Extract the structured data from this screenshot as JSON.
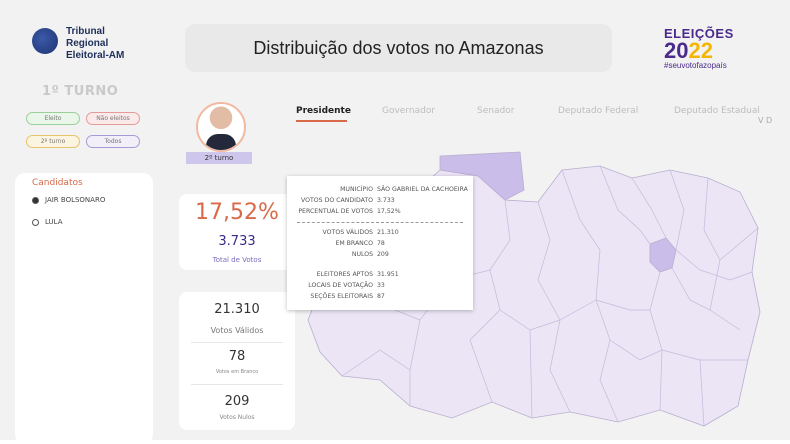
{
  "header": {
    "org_lines": [
      "Tribunal",
      "Regional",
      "Eleitoral-AM"
    ],
    "title": "Distribuição dos votos no Amazonas",
    "election_word": "ELEIÇÕES",
    "election_year_a": "20",
    "election_year_b": "22",
    "election_hashtag": "#seuvotofazopaís"
  },
  "turno": "1º TURNO",
  "filters": [
    "Eleito",
    "Não eleitos",
    "2º turno",
    "Todos"
  ],
  "candidates": {
    "title": "Candidatos",
    "items": [
      {
        "label": "JAIR BOLSONARO",
        "selected": true
      },
      {
        "label": "LULA",
        "selected": false
      }
    ]
  },
  "photo_badge": "2º turno",
  "tabs": [
    "Presidente",
    "Governador",
    "Senador",
    "Deputado Federal",
    "Deputado Estadual"
  ],
  "scroll_indicator": "V D",
  "summary": {
    "percent": "17,52%",
    "votes": "3.733",
    "votes_label": "Total de Votos"
  },
  "stats": [
    {
      "value": "21.310",
      "label": "Votos Válidos"
    },
    {
      "value": "78",
      "label": "Votos em Branco"
    },
    {
      "value": "209",
      "label": "Votos Nulos"
    }
  ],
  "tooltip": {
    "group1": [
      {
        "k": "MUNICÍPIO",
        "v": "SÃO GABRIEL DA CACHOEIRA"
      },
      {
        "k": "VOTOS DO CANDIDATO",
        "v": "3.733"
      },
      {
        "k": "PERCENTUAL DE VOTOS",
        "v": "17,52%"
      }
    ],
    "group2": [
      {
        "k": "VOTOS VÁLIDOS",
        "v": "21.310"
      },
      {
        "k": "EM BRANCO",
        "v": "78"
      },
      {
        "k": "NULOS",
        "v": "209"
      }
    ],
    "group3": [
      {
        "k": "ELEITORES APTOS",
        "v": "31.951"
      },
      {
        "k": "LOCAIS DE VOTAÇÃO",
        "v": "33"
      },
      {
        "k": "SEÇÕES ELEITORAIS",
        "v": "87"
      }
    ]
  },
  "colors": {
    "accent": "#d86a4a",
    "brand_purple": "#4a2a8c",
    "map_fill": "#ebe5f5",
    "map_highlight": "#cbbde9"
  }
}
